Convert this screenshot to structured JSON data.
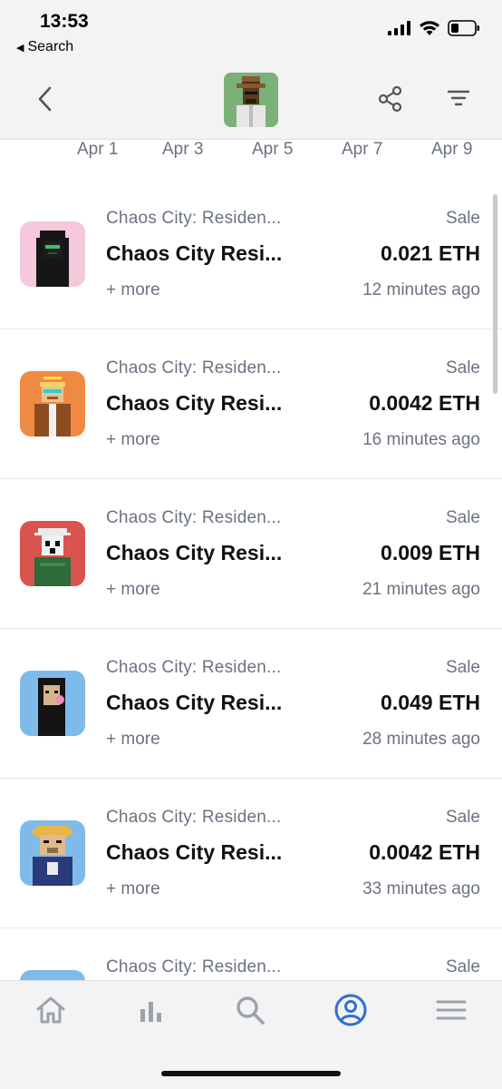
{
  "status_bar": {
    "time": "13:53",
    "back_app_label": "Search"
  },
  "nav": {
    "back_icon": "chevron-left-icon",
    "share_icon": "share-icon",
    "filter_icon": "filter-icon"
  },
  "date_axis": [
    "Apr 1",
    "Apr 3",
    "Apr 5",
    "Apr 7",
    "Apr 9"
  ],
  "activity": [
    {
      "collection": "Chaos City: Residen...",
      "name": "Chaos City Resi...",
      "more": "+ more",
      "event": "Sale",
      "price": "0.021 ETH",
      "time": "12 minutes ago",
      "thumb_bg": "#f6c8dc"
    },
    {
      "collection": "Chaos City: Residen...",
      "name": "Chaos City Resi...",
      "more": "+ more",
      "event": "Sale",
      "price": "0.0042 ETH",
      "time": "16 minutes ago",
      "thumb_bg": "#ef8a43"
    },
    {
      "collection": "Chaos City: Residen...",
      "name": "Chaos City Resi...",
      "more": "+ more",
      "event": "Sale",
      "price": "0.009 ETH",
      "time": "21 minutes ago",
      "thumb_bg": "#d9534f"
    },
    {
      "collection": "Chaos City: Residen...",
      "name": "Chaos City Resi...",
      "more": "+ more",
      "event": "Sale",
      "price": "0.049 ETH",
      "time": "28 minutes ago",
      "thumb_bg": "#7fbbea"
    },
    {
      "collection": "Chaos City: Residen...",
      "name": "Chaos City Resi...",
      "more": "+ more",
      "event": "Sale",
      "price": "0.0042 ETH",
      "time": "33 minutes ago",
      "thumb_bg": "#7fbbea"
    },
    {
      "collection": "Chaos City: Residen...",
      "name": "",
      "more": "",
      "event": "Sale",
      "price": "",
      "time": "",
      "thumb_bg": "#7fbbea"
    }
  ],
  "tab_bar": {
    "tabs": [
      "home-icon",
      "stats-icon",
      "search-icon",
      "profile-icon",
      "menu-icon"
    ],
    "active_color": "#2f6fd6",
    "inactive_color": "#9aa3ad"
  }
}
